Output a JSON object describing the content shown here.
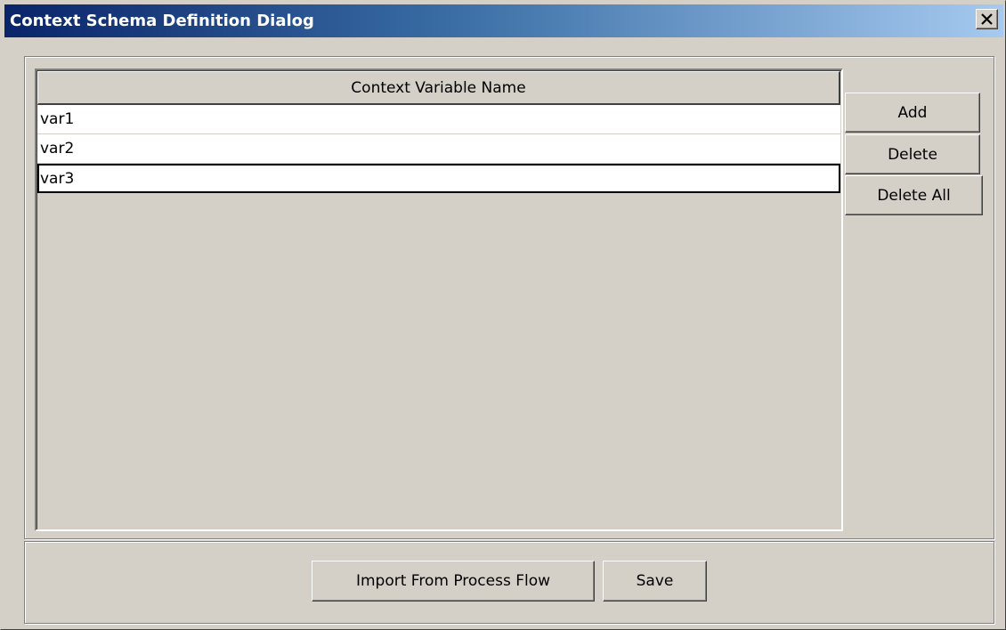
{
  "window": {
    "title": "Context Schema Definition Dialog",
    "close_glyph": "✕",
    "title_gradient": [
      "#0a246a",
      "#a6caf0"
    ]
  },
  "table": {
    "column_header": "Context Variable Name",
    "rows": [
      "var1",
      "var2",
      "var3"
    ],
    "selected_row": "var3"
  },
  "side_buttons": {
    "add": "Add",
    "delete": "Delete",
    "delete_all": "Delete All"
  },
  "footer_buttons": {
    "import": "Import From Process Flow",
    "save": "Save"
  }
}
